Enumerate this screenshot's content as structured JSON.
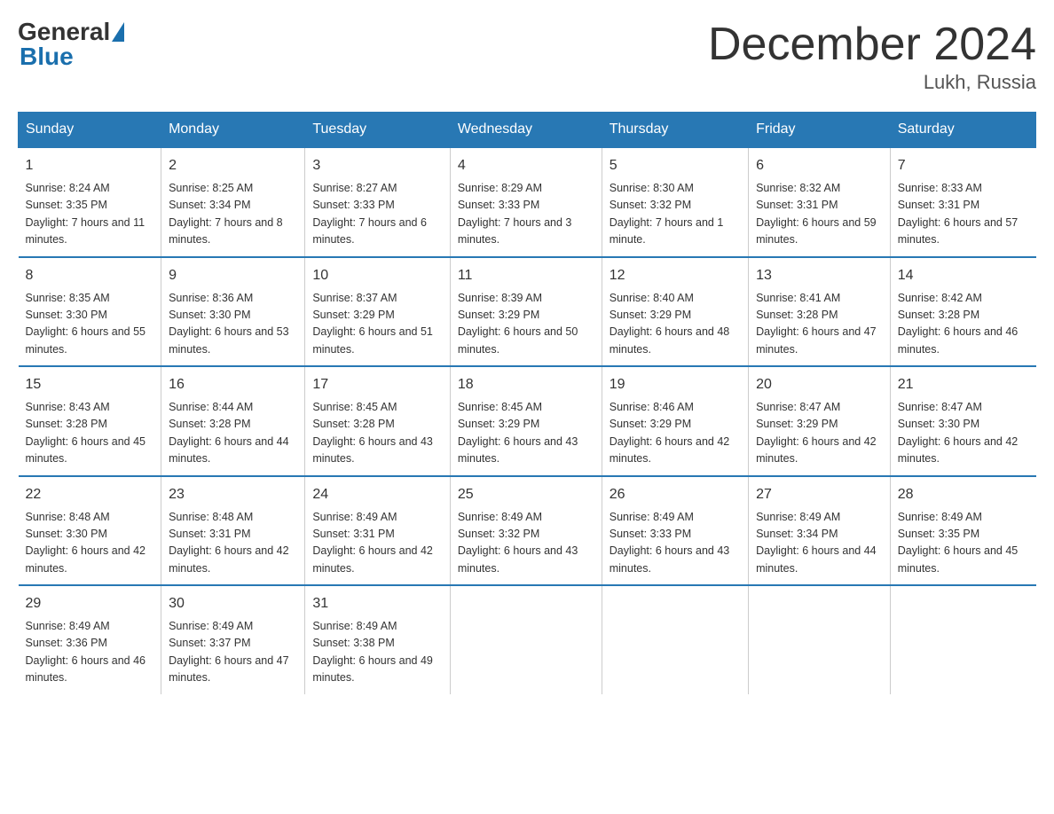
{
  "logo": {
    "general": "General",
    "blue": "Blue"
  },
  "title": "December 2024",
  "location": "Lukh, Russia",
  "days_of_week": [
    "Sunday",
    "Monday",
    "Tuesday",
    "Wednesday",
    "Thursday",
    "Friday",
    "Saturday"
  ],
  "weeks": [
    [
      {
        "day": "1",
        "sunrise": "8:24 AM",
        "sunset": "3:35 PM",
        "daylight": "7 hours and 11 minutes."
      },
      {
        "day": "2",
        "sunrise": "8:25 AM",
        "sunset": "3:34 PM",
        "daylight": "7 hours and 8 minutes."
      },
      {
        "day": "3",
        "sunrise": "8:27 AM",
        "sunset": "3:33 PM",
        "daylight": "7 hours and 6 minutes."
      },
      {
        "day": "4",
        "sunrise": "8:29 AM",
        "sunset": "3:33 PM",
        "daylight": "7 hours and 3 minutes."
      },
      {
        "day": "5",
        "sunrise": "8:30 AM",
        "sunset": "3:32 PM",
        "daylight": "7 hours and 1 minute."
      },
      {
        "day": "6",
        "sunrise": "8:32 AM",
        "sunset": "3:31 PM",
        "daylight": "6 hours and 59 minutes."
      },
      {
        "day": "7",
        "sunrise": "8:33 AM",
        "sunset": "3:31 PM",
        "daylight": "6 hours and 57 minutes."
      }
    ],
    [
      {
        "day": "8",
        "sunrise": "8:35 AM",
        "sunset": "3:30 PM",
        "daylight": "6 hours and 55 minutes."
      },
      {
        "day": "9",
        "sunrise": "8:36 AM",
        "sunset": "3:30 PM",
        "daylight": "6 hours and 53 minutes."
      },
      {
        "day": "10",
        "sunrise": "8:37 AM",
        "sunset": "3:29 PM",
        "daylight": "6 hours and 51 minutes."
      },
      {
        "day": "11",
        "sunrise": "8:39 AM",
        "sunset": "3:29 PM",
        "daylight": "6 hours and 50 minutes."
      },
      {
        "day": "12",
        "sunrise": "8:40 AM",
        "sunset": "3:29 PM",
        "daylight": "6 hours and 48 minutes."
      },
      {
        "day": "13",
        "sunrise": "8:41 AM",
        "sunset": "3:28 PM",
        "daylight": "6 hours and 47 minutes."
      },
      {
        "day": "14",
        "sunrise": "8:42 AM",
        "sunset": "3:28 PM",
        "daylight": "6 hours and 46 minutes."
      }
    ],
    [
      {
        "day": "15",
        "sunrise": "8:43 AM",
        "sunset": "3:28 PM",
        "daylight": "6 hours and 45 minutes."
      },
      {
        "day": "16",
        "sunrise": "8:44 AM",
        "sunset": "3:28 PM",
        "daylight": "6 hours and 44 minutes."
      },
      {
        "day": "17",
        "sunrise": "8:45 AM",
        "sunset": "3:28 PM",
        "daylight": "6 hours and 43 minutes."
      },
      {
        "day": "18",
        "sunrise": "8:45 AM",
        "sunset": "3:29 PM",
        "daylight": "6 hours and 43 minutes."
      },
      {
        "day": "19",
        "sunrise": "8:46 AM",
        "sunset": "3:29 PM",
        "daylight": "6 hours and 42 minutes."
      },
      {
        "day": "20",
        "sunrise": "8:47 AM",
        "sunset": "3:29 PM",
        "daylight": "6 hours and 42 minutes."
      },
      {
        "day": "21",
        "sunrise": "8:47 AM",
        "sunset": "3:30 PM",
        "daylight": "6 hours and 42 minutes."
      }
    ],
    [
      {
        "day": "22",
        "sunrise": "8:48 AM",
        "sunset": "3:30 PM",
        "daylight": "6 hours and 42 minutes."
      },
      {
        "day": "23",
        "sunrise": "8:48 AM",
        "sunset": "3:31 PM",
        "daylight": "6 hours and 42 minutes."
      },
      {
        "day": "24",
        "sunrise": "8:49 AM",
        "sunset": "3:31 PM",
        "daylight": "6 hours and 42 minutes."
      },
      {
        "day": "25",
        "sunrise": "8:49 AM",
        "sunset": "3:32 PM",
        "daylight": "6 hours and 43 minutes."
      },
      {
        "day": "26",
        "sunrise": "8:49 AM",
        "sunset": "3:33 PM",
        "daylight": "6 hours and 43 minutes."
      },
      {
        "day": "27",
        "sunrise": "8:49 AM",
        "sunset": "3:34 PM",
        "daylight": "6 hours and 44 minutes."
      },
      {
        "day": "28",
        "sunrise": "8:49 AM",
        "sunset": "3:35 PM",
        "daylight": "6 hours and 45 minutes."
      }
    ],
    [
      {
        "day": "29",
        "sunrise": "8:49 AM",
        "sunset": "3:36 PM",
        "daylight": "6 hours and 46 minutes."
      },
      {
        "day": "30",
        "sunrise": "8:49 AM",
        "sunset": "3:37 PM",
        "daylight": "6 hours and 47 minutes."
      },
      {
        "day": "31",
        "sunrise": "8:49 AM",
        "sunset": "3:38 PM",
        "daylight": "6 hours and 49 minutes."
      },
      null,
      null,
      null,
      null
    ]
  ]
}
